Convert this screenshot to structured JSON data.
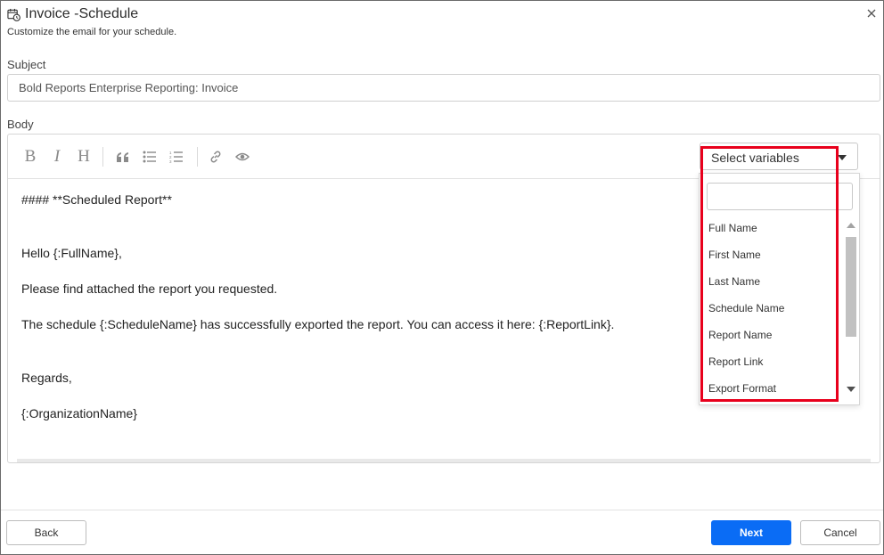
{
  "dialog": {
    "title": "Invoice -Schedule",
    "subtitle": "Customize the email for your schedule."
  },
  "subject": {
    "label": "Subject",
    "value": "Bold Reports Enterprise Reporting: Invoice"
  },
  "body": {
    "label": "Body",
    "toolbar": {
      "icons": [
        "bold-icon",
        "italic-icon",
        "heading-icon",
        "quote-icon",
        "unordered-list-icon",
        "ordered-list-icon",
        "link-icon",
        "preview-icon"
      ]
    },
    "variables_select": {
      "label": "Select variables"
    },
    "content_lines": [
      "#### **Scheduled Report**",
      "Hello {:FullName},",
      "Please find attached the report you requested.",
      "The schedule {:ScheduleName} has successfully exported the report. You can access it here: {:ReportLink}.",
      "Regards,",
      "{:OrganizationName}"
    ]
  },
  "variables_dropdown": {
    "search_value": "",
    "items": [
      "Full Name",
      "First Name",
      "Last Name",
      "Schedule Name",
      "Report Name",
      "Report Link",
      "Export Format"
    ]
  },
  "footer": {
    "back_label": "Back",
    "next_label": "Next",
    "cancel_label": "Cancel"
  },
  "colors": {
    "primary": "#0a6cf5",
    "highlight": "#e8001c"
  }
}
